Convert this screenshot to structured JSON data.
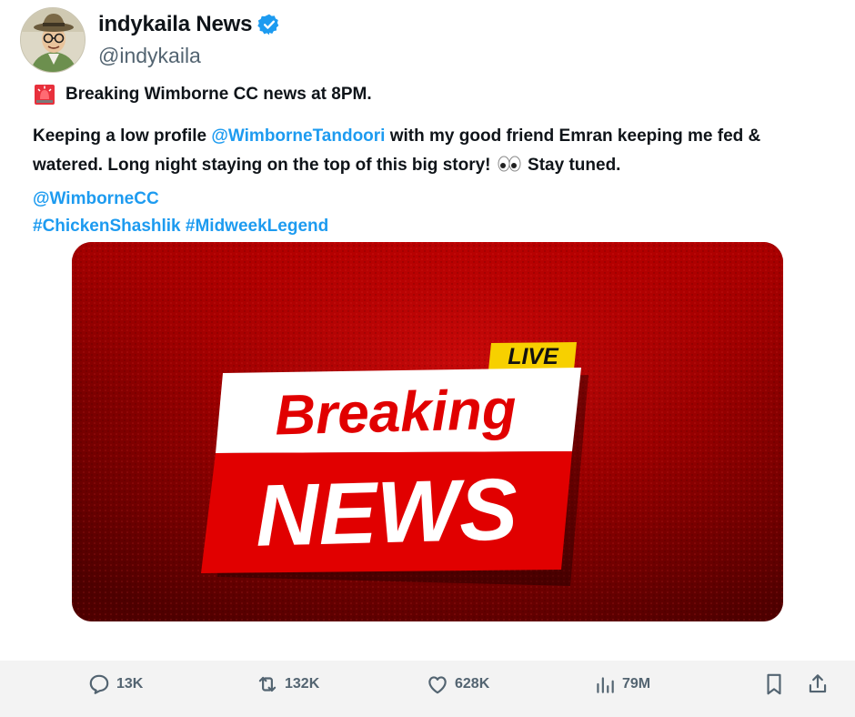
{
  "tweet": {
    "display_name": "indykaila News",
    "handle": "@indykaila",
    "alert_line": "Breaking Wimborne CC news at 8PM.",
    "body": {
      "part1": "Keeping a low profile ",
      "mention": "@WimborneTandoori",
      "part2": " with my good friend Emran keeping me fed & watered. Long night staying on the top of this big story! ",
      "part3": " Stay tuned."
    },
    "tag_mention": "@WimborneCC",
    "hashtags": [
      "#ChickenShashlik",
      "#MidweekLegend"
    ]
  },
  "media": {
    "live_label": "LIVE",
    "headline_top": "Breaking",
    "headline_bottom": "NEWS"
  },
  "actions": {
    "replies": "13K",
    "reposts": "132K",
    "likes": "628K",
    "views": "79M"
  },
  "colors": {
    "link": "#1d9bf0",
    "verified": "#1d9bf0",
    "muted": "#536471",
    "banner_red": "#e10000",
    "live_yellow": "#f7d000"
  },
  "icons": [
    "verified-badge-icon",
    "siren-icon",
    "eyes-icon",
    "reply-icon",
    "repost-icon",
    "like-icon",
    "views-icon",
    "bookmark-icon",
    "share-icon"
  ]
}
